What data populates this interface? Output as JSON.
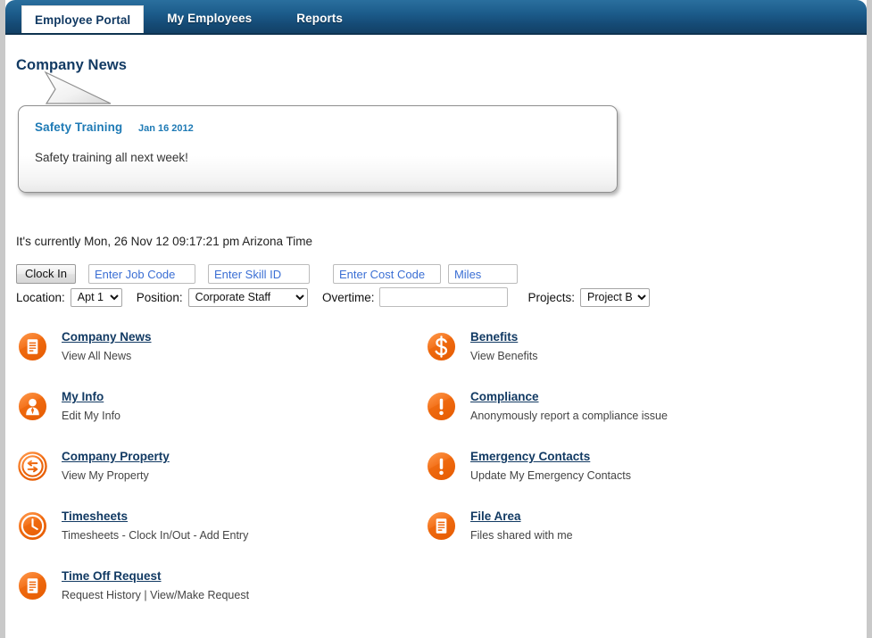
{
  "nav": {
    "tabs": [
      {
        "label": "Employee Portal",
        "active": true
      },
      {
        "label": "My Employees",
        "active": false
      },
      {
        "label": "Reports",
        "active": false
      }
    ]
  },
  "page": {
    "title": "Company News"
  },
  "news": {
    "headline": "Safety Training",
    "date": "Jan 16 2012",
    "body": "Safety training all next week!"
  },
  "clock": {
    "current_time_text": "It's currently Mon, 26 Nov 12 09:17:21 pm Arizona Time",
    "clock_in_label": "Clock In",
    "job_code_placeholder": "Enter Job Code",
    "job_code_value": "",
    "skill_id_placeholder": "Enter Skill ID",
    "skill_id_value": "",
    "cost_code_placeholder": "Enter Cost Code",
    "cost_code_value": "",
    "miles_placeholder": "Miles",
    "miles_value": "",
    "location_label": "Location:",
    "location_value": "Apt 1",
    "position_label": "Position:",
    "position_value": "Corporate Staff",
    "overtime_label": "Overtime:",
    "overtime_value": "",
    "projects_label": "Projects:",
    "projects_value": "Project B"
  },
  "links": {
    "left": [
      {
        "title": "Company News",
        "sub": "View All News",
        "icon": "document-icon"
      },
      {
        "title": "My Info",
        "sub": "Edit My Info",
        "icon": "person-icon"
      },
      {
        "title": "Company Property",
        "sub": "View My Property",
        "icon": "exchange-arrows-icon"
      },
      {
        "title": "Timesheets",
        "sub": "Timesheets - Clock In/Out - Add Entry",
        "icon": "clock-icon"
      },
      {
        "title": "Time Off Request",
        "sub": "Request History | View/Make Request",
        "icon": "document-icon"
      }
    ],
    "right": [
      {
        "title": "Benefits",
        "sub": "View Benefits",
        "icon": "dollar-icon"
      },
      {
        "title": "Compliance",
        "sub": "Anonymously report a compliance issue",
        "icon": "exclamation-icon"
      },
      {
        "title": "Emergency Contacts",
        "sub": "Update My Emergency Contacts",
        "icon": "exclamation-icon"
      },
      {
        "title": "File Area",
        "sub": "Files shared with me",
        "icon": "document-icon"
      }
    ]
  },
  "colors": {
    "nav_blue": "#154a75",
    "accent_orange": "#f4741e",
    "link_navy": "#123a63",
    "news_blue": "#1e7ab5",
    "input_text_blue": "#3b6fd4"
  }
}
